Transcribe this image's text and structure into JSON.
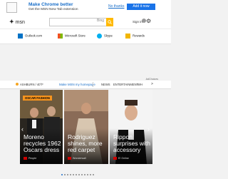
{
  "promo": {
    "title": "Make Chrome better",
    "subtitle": "Get the MSN New Tab extension",
    "no_thanks": "No thanks",
    "add_now": "Add it now"
  },
  "header": {
    "logo": "msn",
    "search_brand": "Bing",
    "signin": "Sign in"
  },
  "shortcuts": [
    "Outlook.com",
    "Microsoft Store",
    "Skype",
    "Rewards"
  ],
  "ad_label": "AdChoices",
  "location": {
    "city": "ASHBURN / 40°F",
    "make_home": "Make MSN my homepage",
    "nav": [
      "NEWS",
      "ENTERTAINMENT",
      "WH"
    ],
    "more": ">"
  },
  "cards": [
    {
      "tag": "OSCAR FASHION",
      "headline": "Moreno recycles 1962 Oscars dress",
      "source": "People"
    },
    {
      "tag": "",
      "headline": "Rodriguez shines, more red carpet",
      "source": "Wonderwall"
    },
    {
      "tag": "",
      "headline": "Rippon surprises with accessory",
      "source": "E! Online"
    }
  ],
  "colors": {
    "accent": "#1a6fc9",
    "tag": "#f7941d",
    "search_btn": "#ffb900"
  }
}
